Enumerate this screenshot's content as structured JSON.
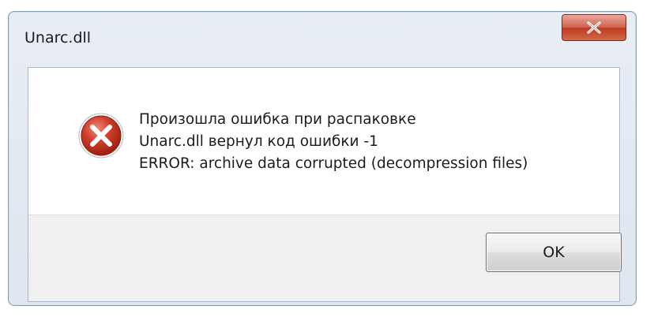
{
  "window": {
    "title": "Unarc.dll"
  },
  "title_buttons": {
    "close_icon": "close-icon"
  },
  "icon": "error-icon",
  "message": {
    "lines": [
      "Произошла ошибка при распаковке",
      "Unarc.dll вернул код ошибки -1",
      "ERROR: archive data corrupted (decompression files)"
    ]
  },
  "buttons": {
    "ok_label": "OK"
  },
  "colors": {
    "close_button": "#c0391f",
    "error_icon": "#c42b1c",
    "window_frame": "#dfe6ef"
  }
}
